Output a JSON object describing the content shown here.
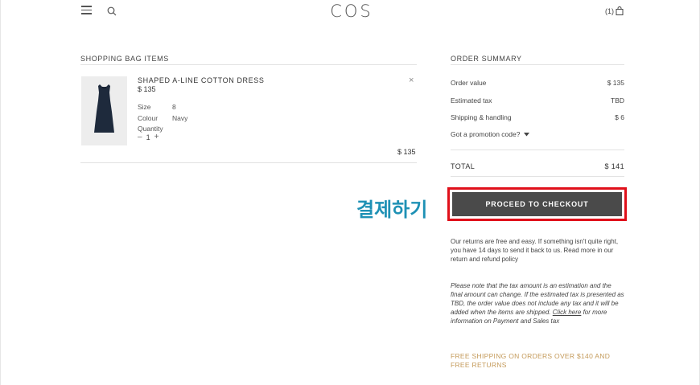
{
  "header": {
    "logo": "COS",
    "bag_count": "(1)"
  },
  "bag": {
    "title": "SHOPPING BAG ITEMS",
    "item": {
      "name": "SHAPED A-LINE COTTON DRESS",
      "price": "$ 135",
      "size_label": "Size",
      "size_value": "8",
      "colour_label": "Colour",
      "colour_value": "Navy",
      "quantity_label": "Quantity",
      "quantity_minus": "–",
      "quantity_value": "1",
      "quantity_plus": "+",
      "remove": "×",
      "line_total": "$ 135"
    }
  },
  "summary": {
    "title": "ORDER SUMMARY",
    "order_value_label": "Order value",
    "order_value": "$ 135",
    "tax_label": "Estimated tax",
    "tax_value": "TBD",
    "shipping_label": "Shipping & handling",
    "shipping_value": "$ 6",
    "promo_label": "Got a promotion code?",
    "total_label": "TOTAL",
    "total_value": "$ 141",
    "checkout_label": "PROCEED TO CHECKOUT",
    "annotation": "결제하기",
    "returns_text": "Our returns are free and easy. If something isn't quite right, you have 14 days to send it back to us. Read more in our return and refund policy",
    "tax_note_before": "Please note that the tax amount is an estimation and the final amount can change.  If the estimated tax is presented as TBD, the order value does not include any tax and it will be added when the items are shipped.",
    "tax_note_link": "Click here",
    "tax_note_after": "for more information on Payment and Sales tax",
    "free_shipping": "FREE SHIPPING ON ORDERS OVER $140 AND FREE RETURNS"
  },
  "colors": {
    "accent_gold": "#c49a5a",
    "checkout_bg": "#4a4a4a",
    "highlight_red": "#e0101a",
    "annotation_blue": "#1e91b5"
  },
  "icons": [
    "hamburger-menu-icon",
    "search-icon",
    "shopping-bag-icon",
    "close-icon",
    "chevron-down-icon",
    "dress-image"
  ]
}
